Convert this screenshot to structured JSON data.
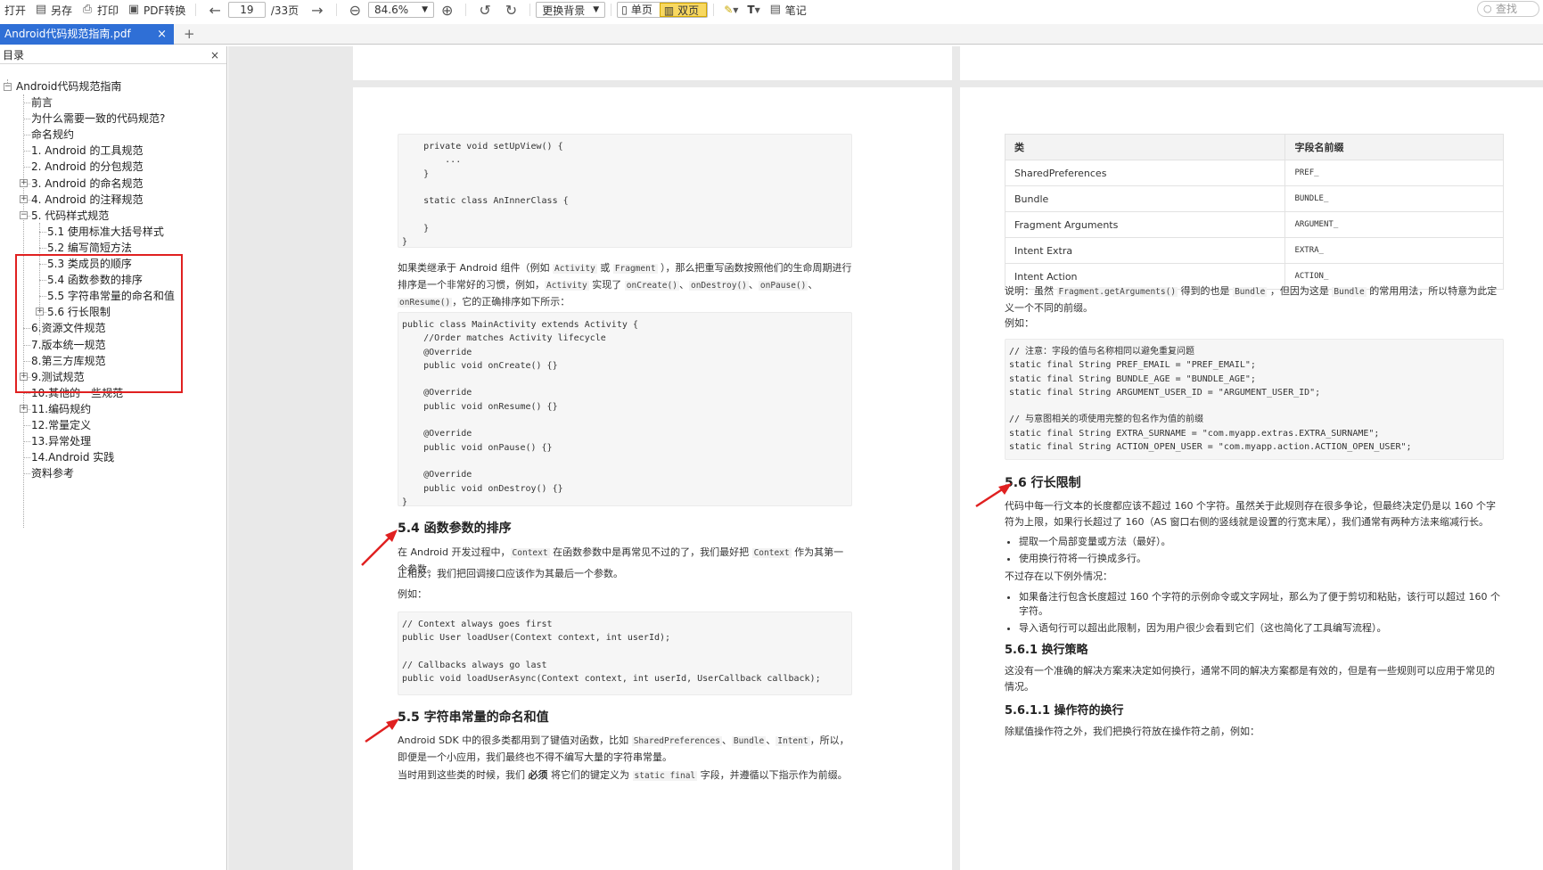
{
  "toolbar": {
    "open": "打开",
    "save_as": "另存",
    "print": "打印",
    "pdf_convert": "PDF转换",
    "page_current": "19",
    "page_total": "/33页",
    "zoom": "84.6%",
    "background": "更换背景",
    "single_page": "单页",
    "double_page": "双页",
    "notes": "笔记",
    "search_placeholder": "查找"
  },
  "tab": {
    "title": "Android代码规范指南.pdf",
    "close": "×",
    "new": "+"
  },
  "sidebar": {
    "title": "目录",
    "close": "×",
    "root": "Android代码规范指南",
    "items": [
      "前言",
      "为什么需要一致的代码规范?",
      "命名规约",
      "1. Android 的工具规范",
      "2. Android 的分包规范",
      "3. Android 的命名规范",
      "4. Android 的注释规范",
      "5. 代码样式规范",
      "5.1 使用标准大括号样式",
      "5.2 编写简短方法",
      "5.3 类成员的顺序",
      "5.4 函数参数的排序",
      "5.5 字符串常量的命名和值",
      "5.6 行长限制",
      "6.资源文件规范",
      "7.版本统一规范",
      "8.第三方库规范",
      "9.测试规范",
      "10.其他的一些规范",
      "11.编码规约",
      "12.常量定义",
      "13.异常处理",
      "14.Android 实践",
      "资料参考"
    ]
  },
  "left_page": {
    "code1": "    private void setUpView() {\n        ...\n    }\n\n    static class AnInnerClass {\n\n    }\n}",
    "para1": [
      "如果类继承于 Android 组件（例如 ",
      "Activity",
      " 或 ",
      "Fragment",
      " ），那么把重写函数按照他们的生命周期进行排序是一个非常好的习惯，例如，",
      "Activity",
      " 实现了 ",
      "onCreate()",
      "、",
      "onDestroy()",
      "、",
      "onPause()",
      "、",
      "onResume()",
      "，它的正确排序如下所示："
    ],
    "code2": "public class MainActivity extends Activity {\n    //Order matches Activity lifecycle\n    @Override\n    public void onCreate() {}\n\n    @Override\n    public void onResume() {}\n\n    @Override\n    public void onPause() {}\n\n    @Override\n    public void onDestroy() {}\n}",
    "h_54": "5.4 函数参数的排序",
    "para2": [
      "在 Android 开发过程中，",
      "Context",
      " 在函数参数中是再常见不过的了，我们最好把 ",
      "Context",
      " 作为其第一个参数。"
    ],
    "para3": "正相反，我们把回调接口应该作为其最后一个参数。",
    "para4": "例如：",
    "code3": "// Context always goes first\npublic User loadUser(Context context, int userId);\n\n// Callbacks always go last\npublic void loadUserAsync(Context context, int userId, UserCallback callback);",
    "h_55": "5.5 字符串常量的命名和值",
    "para5": [
      "Android SDK 中的很多类都用到了键值对函数，比如 ",
      "SharedPreferences",
      "、",
      "Bundle",
      "、",
      "Intent",
      "，所以，即便是一个小应用，我们最终也不得不编写大量的字符串常量。"
    ],
    "para6": [
      "当时用到这些类的时候，我们 ",
      "必须",
      " 将它们的键定义为 ",
      "static final",
      " 字段，并遵循以下指示作为前缀。"
    ]
  },
  "right_page": {
    "table_headers": [
      "类",
      "字段名前缀"
    ],
    "table_rows": [
      [
        "SharedPreferences",
        "PREF_"
      ],
      [
        "Bundle",
        "BUNDLE_"
      ],
      [
        "Fragment Arguments",
        "ARGUMENT_"
      ],
      [
        "Intent Extra",
        "EXTRA_"
      ],
      [
        "Intent Action",
        "ACTION_"
      ]
    ],
    "para1": [
      "说明：虽然 ",
      "Fragment.getArguments()",
      " 得到的也是 ",
      "Bundle",
      " ，但因为这是 ",
      "Bundle",
      " 的常用用法，所以特意为此定义一个不同的前缀。"
    ],
    "para2": "例如：",
    "code1": "// 注意：字段的值与名称相同以避免重复问题\nstatic final String PREF_EMAIL = \"PREF_EMAIL\";\nstatic final String BUNDLE_AGE = \"BUNDLE_AGE\";\nstatic final String ARGUMENT_USER_ID = \"ARGUMENT_USER_ID\";\n\n// 与意图相关的项使用完整的包名作为值的前缀\nstatic final String EXTRA_SURNAME = \"com.myapp.extras.EXTRA_SURNAME\";\nstatic final String ACTION_OPEN_USER = \"com.myapp.action.ACTION_OPEN_USER\";",
    "h_56": "5.6 行长限制",
    "para3": "代码中每一行文本的长度都应该不超过 160 个字符。虽然关于此规则存在很多争论，但最终决定仍是以 160 个字符为上限，如果行长超过了 160（AS 窗口右侧的竖线就是设置的行宽末尾），我们通常有两种方法来缩减行长。",
    "bullets1": [
      "提取一个局部变量或方法（最好）。",
      "使用换行符将一行换成多行。"
    ],
    "para4": "不过存在以下例外情况：",
    "bullets2": [
      "如果备注行包含长度超过 160 个字符的示例命令或文字网址，那么为了便于剪切和粘贴，该行可以超过 160 个字符。",
      "导入语句行可以超出此限制，因为用户很少会看到它们（这也简化了工具编写流程）。"
    ],
    "h_561": "5.6.1 换行策略",
    "para5": "这没有一个准确的解决方案来决定如何换行，通常不同的解决方案都是有效的，但是有一些规则可以应用于常见的情况。",
    "h_5611": "5.6.1.1 操作符的换行",
    "para6": "除赋值操作符之外，我们把换行符放在操作符之前，例如："
  },
  "colors": {
    "accent": "#2f6fd6",
    "highlight": "#e02020",
    "toggle_active": "#f8d860"
  },
  "icons": [
    "open-icon",
    "save-as-icon",
    "print-icon",
    "pdf-icon",
    "back-arrow-icon",
    "forward-arrow-icon",
    "zoom-out-icon",
    "zoom-in-icon",
    "rotate-left-icon",
    "rotate-right-icon",
    "highlighter-icon",
    "text-icon",
    "note-icon",
    "search-icon"
  ]
}
